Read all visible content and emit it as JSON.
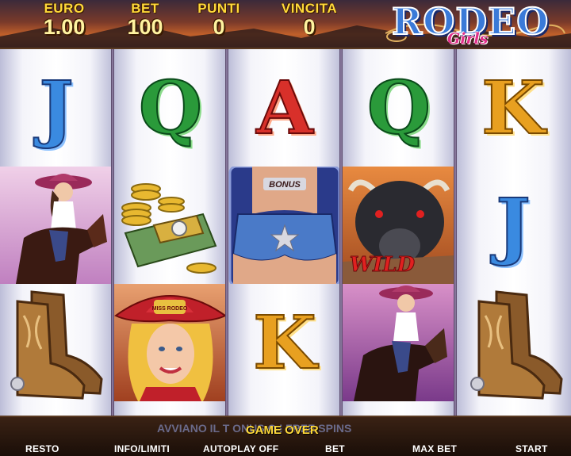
{
  "hud": {
    "euro_label": "EURO",
    "euro_value": "1.00",
    "bet_label": "BET",
    "bet_value": "100",
    "punti_label": "PUNTI",
    "punti_value": "0",
    "vincita_label": "VINCITA",
    "vincita_value": "0"
  },
  "logo": {
    "main": "RODEO",
    "sub": "Girls"
  },
  "reels": [
    [
      "J",
      "cowgirl-rider-symbol",
      "cowboy-boots-symbol"
    ],
    [
      "Q",
      "money-stack-symbol",
      "blonde-cowgirl-symbol"
    ],
    [
      "A",
      "bonus-shorts-symbol",
      "K"
    ],
    [
      "Q",
      "bull-wild-symbol",
      "cowgirl-rider-symbol"
    ],
    [
      "K",
      "J",
      "cowboy-boots-symbol"
    ]
  ],
  "symbols": {
    "bonus_text": "BONUS",
    "wild_text": "WILD",
    "hat_text": "MISS RODEO"
  },
  "status": {
    "message": "GAME OVER",
    "marquee": "AVVIANO IL T          ONUS O I FREE SPINS"
  },
  "buttons": {
    "resto": "RESTO",
    "info": "INFO/LIMITI",
    "autoplay": "AUTOPLAY OFF",
    "bet": "BET",
    "maxbet": "MAX BET",
    "start": "START"
  },
  "colors": {
    "accent": "#ffd93a",
    "reel_bg": "#f4f4fa",
    "frame": "#5a3a22"
  }
}
